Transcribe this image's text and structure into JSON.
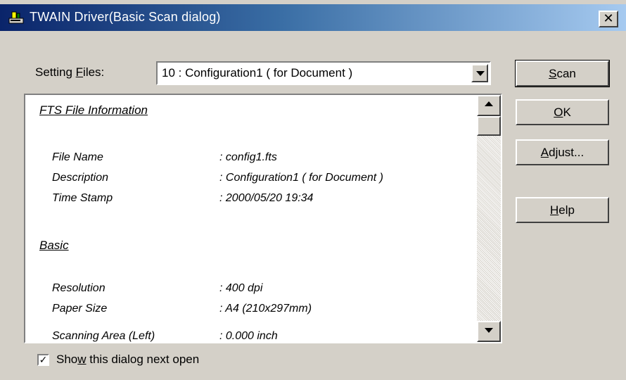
{
  "window": {
    "title": "TWAIN Driver(Basic Scan dialog)",
    "close_glyph": "✕"
  },
  "setting_files": {
    "label_pre": "Setting ",
    "label_mnemonic": "F",
    "label_post": "iles:",
    "selected_value": "10 : Configuration1 ( for Document )"
  },
  "info": {
    "sections": [
      {
        "heading": "FTS File Information",
        "rows": [
          {
            "key": "File Name",
            "value": ": config1.fts"
          },
          {
            "key": "Description",
            "value": ": Configuration1 ( for Document )"
          },
          {
            "key": "Time Stamp",
            "value": ": 2000/05/20 19:34"
          }
        ]
      },
      {
        "heading": "Basic",
        "rows": [
          {
            "key": "Resolution",
            "value": ": 400 dpi"
          },
          {
            "key": "Paper Size",
            "value": ": A4 (210x297mm)"
          },
          {
            "key": "Scanning Area (Left)",
            "value": ": 0.000 inch"
          }
        ]
      }
    ]
  },
  "buttons": {
    "scan": {
      "mnemonic": "S",
      "rest": "can"
    },
    "ok": {
      "mnemonic": "O",
      "rest": "K"
    },
    "adjust": {
      "mnemonic": "A",
      "rest": "djust..."
    },
    "help": {
      "mnemonic": "H",
      "rest": "elp"
    }
  },
  "show_dialog": {
    "checked": true,
    "check_glyph": "✓",
    "label_pre": "Sho",
    "label_mnemonic": "w",
    "label_post": " this dialog next open"
  },
  "icons": {
    "title_icon": "scanner-icon",
    "combo_arrow": "chevron-down-icon",
    "scroll_up": "scroll-up-icon",
    "scroll_down": "scroll-down-icon"
  }
}
